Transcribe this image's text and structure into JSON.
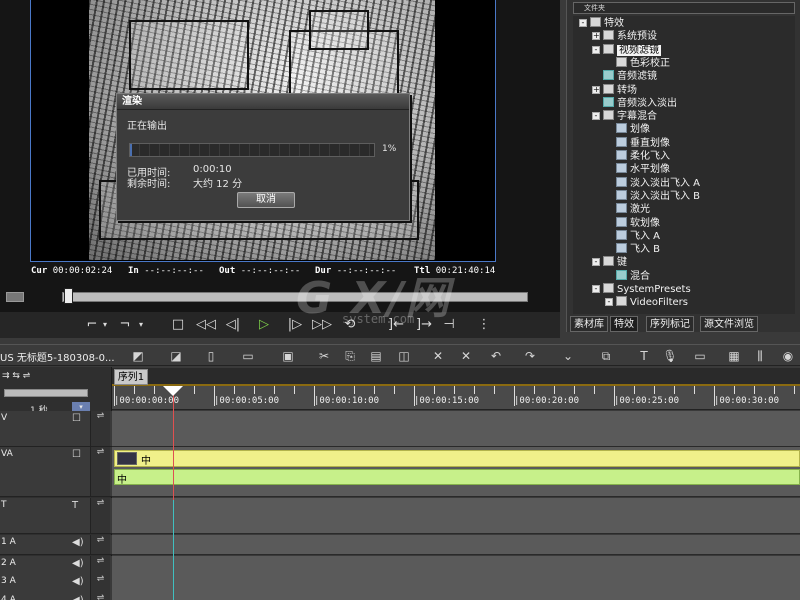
{
  "player": {
    "timecodes": {
      "cur_label": "Cur",
      "cur": "00:00:02:24",
      "in_label": "In",
      "in": "--:--:--:--",
      "out_label": "Out",
      "out": "--:--:--:--",
      "dur_label": "Dur",
      "dur": "--:--:--:--",
      "ttl_label": "Ttl",
      "ttl": "00:21:40:14"
    },
    "scrub_position": 0.005
  },
  "render_dialog": {
    "title": "渲染",
    "status": "正在输出",
    "progress_percent": 1,
    "progress_label": "1%",
    "elapsed_label": "已用时间:",
    "elapsed_value": "0:00:10",
    "remaining_label": "剩余时间:",
    "remaining_value": "大约 12 分",
    "cancel_label": "取消"
  },
  "effects_panel": {
    "header": "文件夹",
    "tree": [
      {
        "label": "特效",
        "icon": "folder",
        "expander": "-",
        "level": 0
      },
      {
        "label": "系统预设",
        "icon": "folder",
        "expander": "+",
        "level": 1
      },
      {
        "label": "视频滤镜",
        "icon": "folder",
        "expander": "-",
        "level": 1,
        "selected": true
      },
      {
        "label": "色彩校正",
        "icon": "folder",
        "expander": "",
        "level": 2
      },
      {
        "label": "音频滤镜",
        "icon": "fx",
        "expander": "",
        "level": 1
      },
      {
        "label": "转场",
        "icon": "folder",
        "expander": "+",
        "level": 1
      },
      {
        "label": "音频淡入淡出",
        "icon": "fx",
        "expander": "",
        "level": 1
      },
      {
        "label": "字幕混合",
        "icon": "folder",
        "expander": "-",
        "level": 1
      },
      {
        "label": "划像",
        "icon": "tt",
        "expander": "",
        "level": 2
      },
      {
        "label": "垂直划像",
        "icon": "tt",
        "expander": "",
        "level": 2
      },
      {
        "label": "柔化飞入",
        "icon": "tt",
        "expander": "",
        "level": 2
      },
      {
        "label": "水平划像",
        "icon": "tt",
        "expander": "",
        "level": 2
      },
      {
        "label": "淡入淡出飞入 A",
        "icon": "tt",
        "expander": "",
        "level": 2
      },
      {
        "label": "淡入淡出飞入 B",
        "icon": "tt",
        "expander": "",
        "level": 2
      },
      {
        "label": "激光",
        "icon": "tt",
        "expander": "",
        "level": 2
      },
      {
        "label": "软划像",
        "icon": "tt",
        "expander": "",
        "level": 2
      },
      {
        "label": "飞入 A",
        "icon": "tt",
        "expander": "",
        "level": 2
      },
      {
        "label": "飞入 B",
        "icon": "tt",
        "expander": "",
        "level": 2
      },
      {
        "label": "键",
        "icon": "folder",
        "expander": "-",
        "level": 1
      },
      {
        "label": "混合",
        "icon": "fx",
        "expander": "",
        "level": 2
      },
      {
        "label": "SystemPresets",
        "icon": "folder",
        "expander": "-",
        "level": 1
      },
      {
        "label": "VideoFilters",
        "icon": "folder",
        "expander": "-",
        "level": 2
      }
    ],
    "tabs": [
      "素材库",
      "特效",
      "序列标记",
      "源文件浏览"
    ],
    "active_tab": 1
  },
  "timeline": {
    "project_name": "US 无标题5-180308-0...",
    "sequence_tab": "序列1",
    "zoom_label": "1 秒",
    "ruler_labels": [
      "|00:00:00:00",
      "|00:00:05:00",
      "|00:00:10:00",
      "|00:00:15:00",
      "|00:00:20:00",
      "|00:00:25:00",
      "|00:00:30:00"
    ],
    "tracks": [
      {
        "name": "V",
        "kind": "video",
        "icon": "☐"
      },
      {
        "name": "VA",
        "kind": "va",
        "icon": "☐"
      },
      {
        "name": "T",
        "kind": "title",
        "icon": "T"
      },
      {
        "name": "1 A",
        "kind": "audio",
        "icon": "◀)"
      },
      {
        "name": "2 A",
        "kind": "audio",
        "icon": "◀)"
      },
      {
        "name": "3 A",
        "kind": "audio",
        "icon": "◀)"
      },
      {
        "name": "4 A",
        "kind": "audio",
        "icon": "◀)"
      }
    ],
    "clip_video_label": "中",
    "clip_audio_label": "中"
  },
  "watermark": {
    "main": "G X/网",
    "sub": "system.com"
  },
  "colors": {
    "accent_blue": "#4a78c8",
    "clip_video": "#f0f08a",
    "clip_audio": "#c7f08a",
    "playhead": "#e05050"
  }
}
